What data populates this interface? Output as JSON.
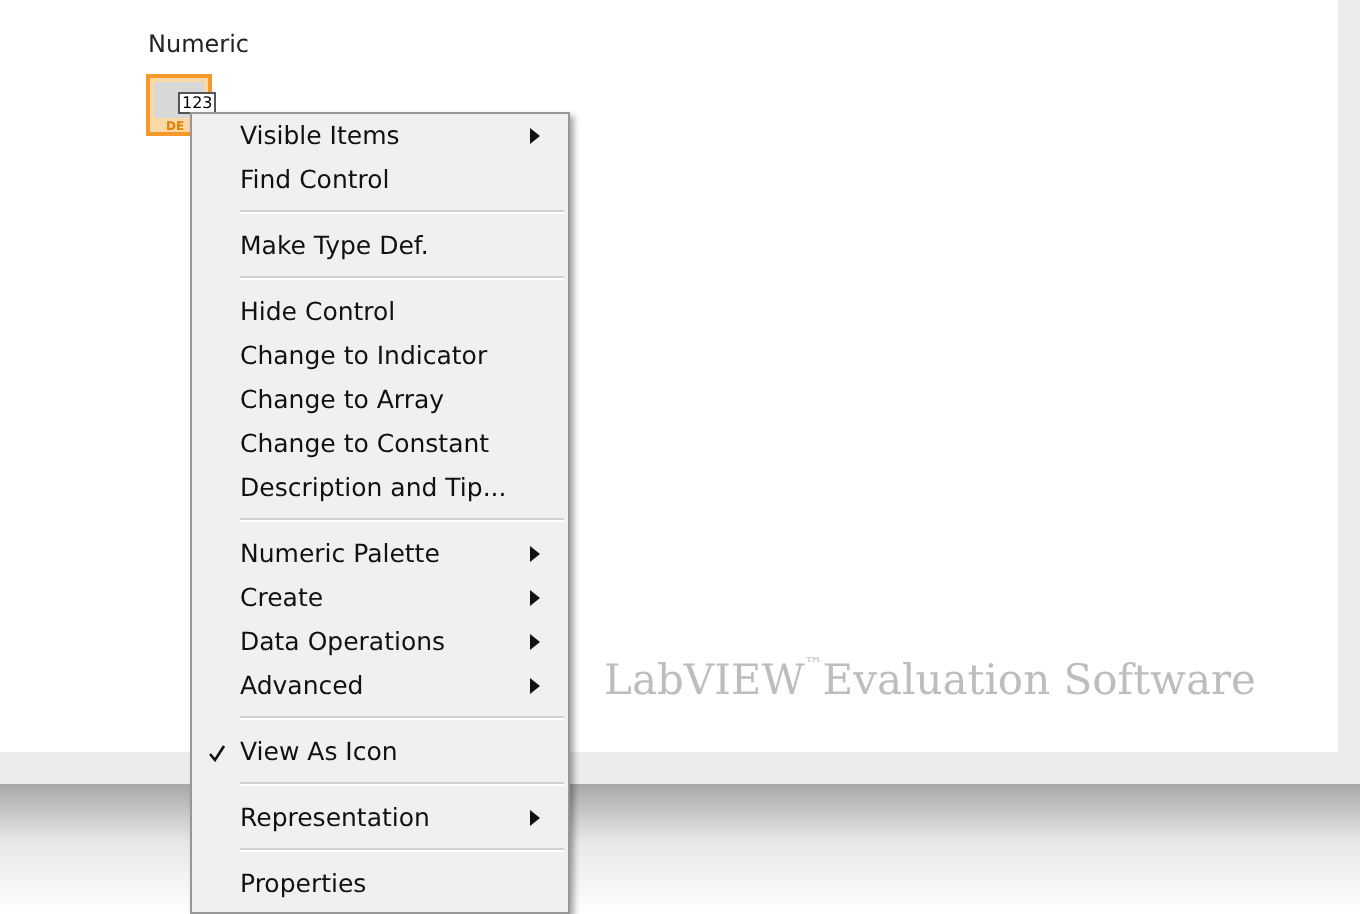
{
  "control": {
    "label": "Numeric",
    "terminal_text": "123",
    "terminal_type": "DE"
  },
  "context_menu": {
    "groups": [
      [
        {
          "label": "Visible Items",
          "submenu": true,
          "checked": false
        },
        {
          "label": "Find Control",
          "submenu": false,
          "checked": false
        }
      ],
      [
        {
          "label": "Make Type Def.",
          "submenu": false,
          "checked": false
        }
      ],
      [
        {
          "label": "Hide Control",
          "submenu": false,
          "checked": false
        },
        {
          "label": "Change to Indicator",
          "submenu": false,
          "checked": false
        },
        {
          "label": "Change to Array",
          "submenu": false,
          "checked": false
        },
        {
          "label": "Change to Constant",
          "submenu": false,
          "checked": false
        },
        {
          "label": "Description and Tip...",
          "submenu": false,
          "checked": false
        }
      ],
      [
        {
          "label": "Numeric Palette",
          "submenu": true,
          "checked": false
        },
        {
          "label": "Create",
          "submenu": true,
          "checked": false
        },
        {
          "label": "Data Operations",
          "submenu": true,
          "checked": false
        },
        {
          "label": "Advanced",
          "submenu": true,
          "checked": false
        }
      ],
      [
        {
          "label": "View As Icon",
          "submenu": false,
          "checked": true
        }
      ],
      [
        {
          "label": "Representation",
          "submenu": true,
          "checked": false
        }
      ],
      [
        {
          "label": "Properties",
          "submenu": false,
          "checked": false
        }
      ]
    ]
  },
  "watermark": {
    "product": "LabVIEW",
    "mark": "™",
    "text": "Evaluation Software"
  }
}
